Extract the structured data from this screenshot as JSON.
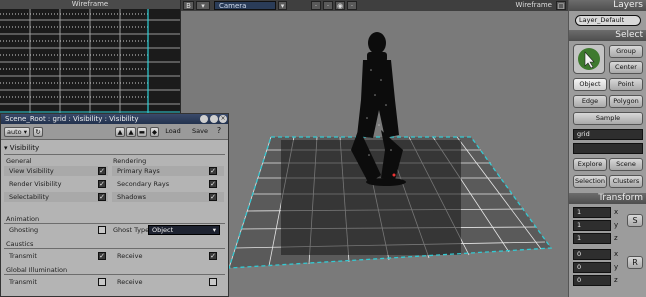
{
  "top_viewport": {
    "title": "Wireframe"
  },
  "main_viewport": {
    "label_b": "B",
    "camera_select": "Camera",
    "mode_label": "Wireframe"
  },
  "right_panel": {
    "layers_title": "Layers",
    "layer_select": "Layer_Default",
    "select_title": "Select",
    "group_button": "Group",
    "center_button": "Center",
    "object_button": "Object",
    "point_button": "Point",
    "edge_button": "Edge",
    "polygon_button": "Polygon",
    "sample_button": "Sample",
    "name_field": "grid",
    "explore_button": "Explore",
    "scene_button": "Scene",
    "selection_button": "Selection",
    "clusters_button": "Clusters",
    "transform_title": "Transform",
    "scale_values": [
      "1",
      "1",
      "1"
    ],
    "rotate_values": [
      "0",
      "0",
      "0"
    ],
    "axis_labels": [
      "x",
      "y",
      "z"
    ],
    "side_labels": [
      "S",
      "R"
    ]
  },
  "dialog": {
    "title": "Scene_Root : grid : Visibility : Visibility",
    "auto_label": "auto",
    "load_label": "Load",
    "save_label": "Save",
    "help_label": "?",
    "section_visibility": "Visibility",
    "group_general": "General",
    "group_rendering": "Rendering",
    "general_options": [
      "View Visibility",
      "Render Visibility",
      "Selectability"
    ],
    "rendering_options": [
      "Primary Rays",
      "Secondary Rays",
      "Shadows"
    ],
    "section_animation": "Animation",
    "ghosting_label": "Ghosting",
    "ghost_type_label": "Ghost Type",
    "ghost_type_value": "Object",
    "section_caustics": "Caustics",
    "caustics_options": [
      "Transmit",
      "Receive"
    ],
    "section_gi": "Global Illumination",
    "gi_options": [
      "Transmit",
      "Receive"
    ]
  }
}
